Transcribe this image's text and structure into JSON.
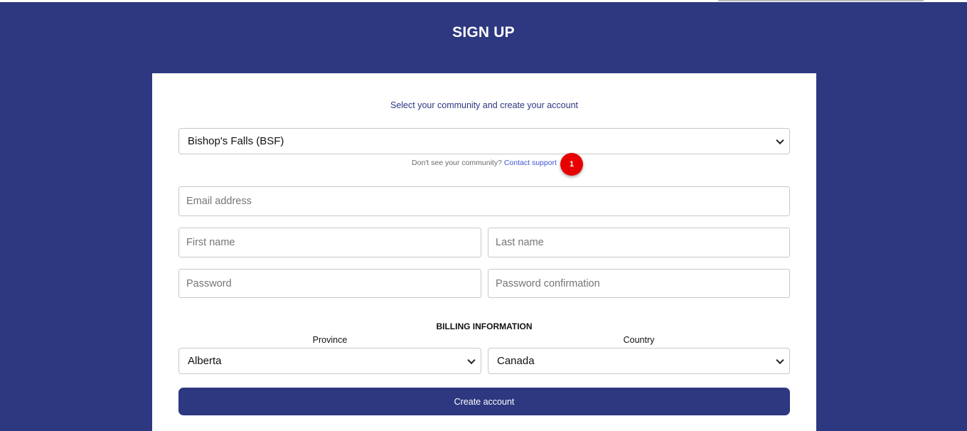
{
  "page": {
    "title": "SIGN UP"
  },
  "form": {
    "subtitle": "Select your community and create your account",
    "community_select": {
      "selected": "Bishop's Falls (BSF)"
    },
    "helper": {
      "text": "Don't see your community?",
      "link": "Contact support"
    },
    "badge": "1",
    "email": {
      "placeholder": "Email address",
      "value": ""
    },
    "first_name": {
      "placeholder": "First name",
      "value": ""
    },
    "last_name": {
      "placeholder": "Last name",
      "value": ""
    },
    "password": {
      "placeholder": "Password",
      "value": ""
    },
    "password_confirmation": {
      "placeholder": "Password confirmation",
      "value": ""
    },
    "billing": {
      "heading": "BILLING INFORMATION",
      "province_label": "Province",
      "province_selected": "Alberta",
      "country_label": "Country",
      "country_selected": "Canada"
    },
    "submit_label": "Create account"
  },
  "colors": {
    "brand": "#2d3880",
    "link": "#3d55d4",
    "badge": "#e60000",
    "card": "#ffffff"
  },
  "icons": {
    "select_arrow": "chevron-down-icon"
  }
}
